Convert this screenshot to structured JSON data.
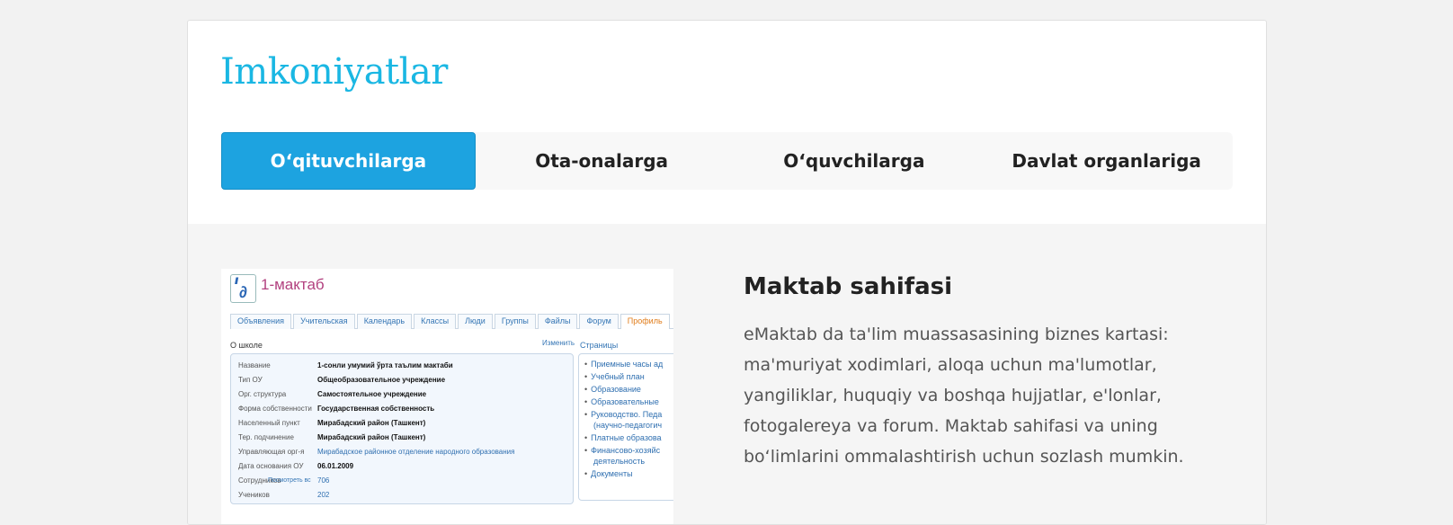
{
  "page_title": "Imkoniyatlar",
  "tabs": [
    {
      "label": "O‘qituvchilarga",
      "active": true
    },
    {
      "label": "Ota-onalarga",
      "active": false
    },
    {
      "label": "O‘quvchilarga",
      "active": false
    },
    {
      "label": "Davlat organlariga",
      "active": false
    }
  ],
  "section": {
    "title": "Maktab sahifasi",
    "description": "eMaktab da ta'lim muassasasining biznes kartasi: ma'muriyat xodimlari, aloqa uchun ma'lumotlar, yangiliklar, huquqiy va boshqa hujjatlar, e'lonlar, fotogalereya va forum. Maktab sahifasi va uning bo‘limlarini ommalashtirish uchun sozlash mumkin."
  },
  "screenshot": {
    "school_name": "1-мактаб",
    "nav": [
      "Объявления",
      "Учительская",
      "Календарь",
      "Классы",
      "Люди",
      "Группы",
      "Файлы",
      "Форум",
      "Профиль"
    ],
    "about_heading": "О школе",
    "edit_link": "Изменить",
    "info_rows": [
      {
        "k": "Название",
        "v": "1-сонли умумий ўрта таълим мактаби"
      },
      {
        "k": "Тип ОУ",
        "v": "Общеобразовательное учреждение"
      },
      {
        "k": "Орг. структура",
        "v": "Самостоятельное учреждение"
      },
      {
        "k": "Форма собственности",
        "v": "Государственная собственность"
      },
      {
        "k": "Населенный пункт",
        "v": "Мирабадский район (Ташкент)"
      },
      {
        "k": "Тер. подчинение",
        "v": "Мирабадский район (Ташкент)"
      },
      {
        "k": "Управляющая орг-я",
        "v": "Мирабадское районное отделение народного образования"
      },
      {
        "k": "Дата основания ОУ",
        "v": "06.01.2009"
      },
      {
        "k": "Сотрудников",
        "v": "706"
      },
      {
        "k": "Учеников",
        "v": "202"
      }
    ],
    "pages_heading": "Страницы",
    "pages": [
      "Приемные часы ад",
      "Учебный план",
      "Образование",
      "Образовательные",
      "Руководство. Педа",
      "(научно-педагогич",
      "Платные образова",
      "Финансово-хозяйс",
      "деятельность",
      "Документы"
    ],
    "pages_more": "Посмотреть вс"
  }
}
